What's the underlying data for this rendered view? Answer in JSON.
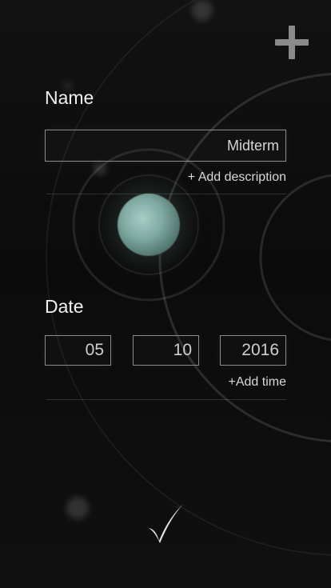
{
  "header": {
    "add_icon": "plus-icon"
  },
  "form": {
    "name_label": "Name",
    "name_value": "Midterm",
    "add_description_label": "+ Add description",
    "date_label": "Date",
    "date_month": "05",
    "date_day": "10",
    "date_year": "2016",
    "add_time_label": "+Add time"
  },
  "footer": {
    "confirm_icon": "checkmark-icon"
  },
  "colors": {
    "background": "#0c0c0c",
    "text": "#f0f0f0",
    "field_border": "#8a8a8a",
    "planet": "#7fa9a1"
  }
}
